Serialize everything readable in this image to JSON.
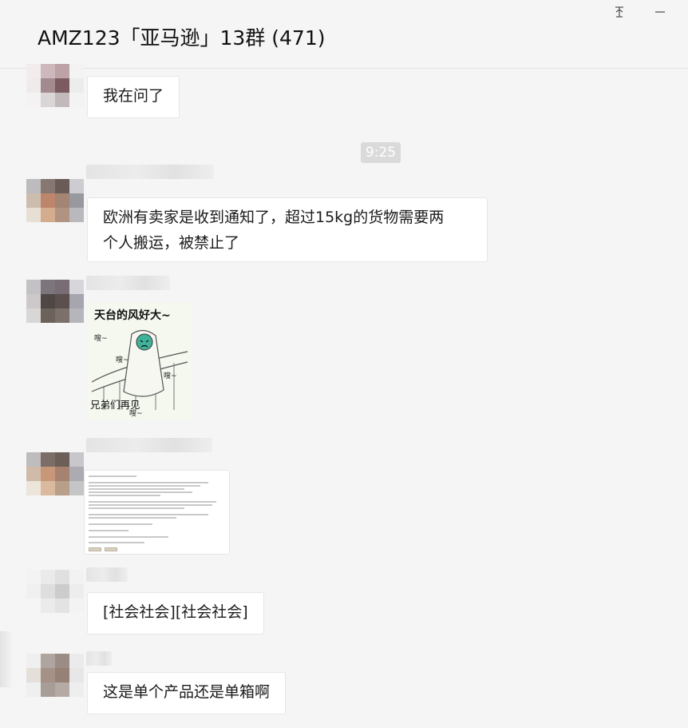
{
  "window": {
    "title": "AMZ123「亚马逊」13群 (471)",
    "pin_icon": "pin-icon",
    "minimize_icon": "minimize-icon"
  },
  "timestamp": "9:25",
  "messages": [
    {
      "type": "text",
      "text": "我在问了"
    },
    {
      "type": "text",
      "text_line1": "欧洲有卖家是收到通知了，超过15kg的货物需要两",
      "text_line2": "个人搬运，被禁止了"
    },
    {
      "type": "sticker",
      "title": "天台的风好大~",
      "caption": "兄弟们再见"
    },
    {
      "type": "image",
      "description": "document-screenshot"
    },
    {
      "type": "text",
      "text": "[社会社会][社会社会]"
    },
    {
      "type": "text",
      "text": "这是单个产品还是单箱啊"
    }
  ]
}
